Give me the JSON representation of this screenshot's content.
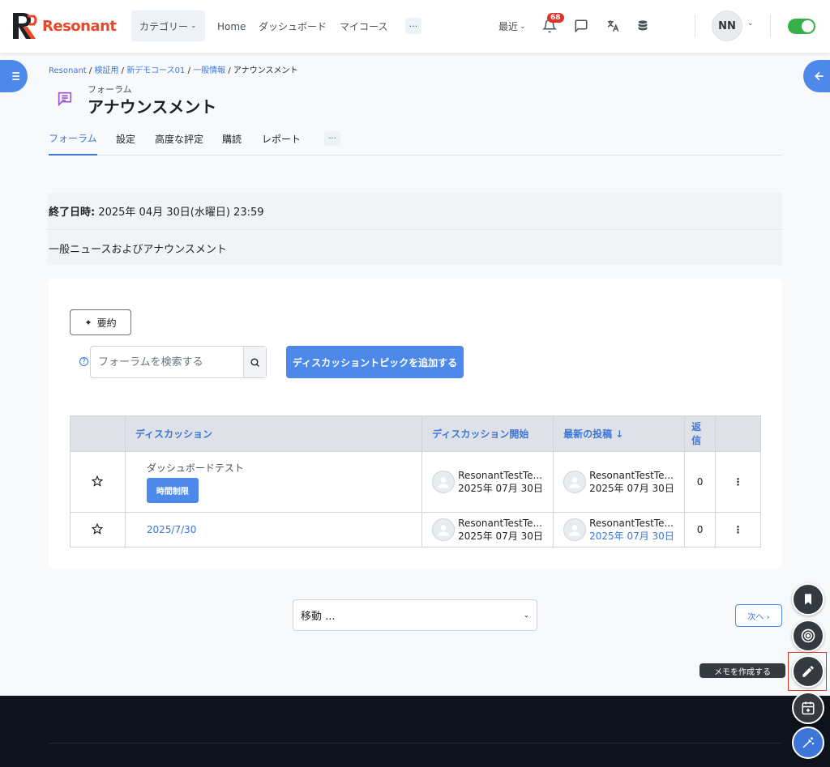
{
  "brand": {
    "name": "Resonant"
  },
  "nav": {
    "category_label": "カテゴリー",
    "links": [
      "Home",
      "ダッシュボード",
      "マイコース"
    ],
    "more": "···",
    "recent_label": "最近",
    "notification_count": "68",
    "user_initials": "NN"
  },
  "breadcrumb": {
    "items": [
      "Resonant",
      "検証用",
      "新デモコース01",
      "一般情報"
    ],
    "current": "アナウンスメント"
  },
  "page": {
    "subtitle": "フォーラム",
    "title": "アナウンスメント"
  },
  "tabs": [
    "フォーラム",
    "設定",
    "高度な評定",
    "購読",
    "レポート"
  ],
  "tabs_more": "···",
  "due": {
    "label": "終了日時:",
    "value": "2025年 04月 30日(水曜日) 23:59"
  },
  "description": "一般ニュースおよびアナウンスメント",
  "toolbar": {
    "summary_label": "要約",
    "search_placeholder": "フォーラムを検索する",
    "add_topic_label": "ディスカッショントピックを追加する"
  },
  "table": {
    "headers": {
      "discussion": "ディスカッション",
      "started": "ディスカッション開始",
      "latest": "最新の投稿 ↓",
      "replies": "返信"
    },
    "rows": [
      {
        "name": "ダッシュボードテスト",
        "badge": "時間制限",
        "started_by": "ResonantTestTe...",
        "started_date": "2025年 07月 30日",
        "latest_by": "ResonantTestTe...",
        "latest_date": "2025年 07月 30日",
        "replies": "0"
      },
      {
        "name": "2025/7/30",
        "started_by": "ResonantTestTe...",
        "started_date": "2025年 07月 30日",
        "latest_by": "ResonantTestTe...",
        "latest_date": "2025年 07月 30日",
        "replies": "0"
      }
    ]
  },
  "jump": {
    "label": "移動 ..."
  },
  "next": {
    "label": "次へ ›"
  },
  "tooltip": "メモを作成する",
  "colors": {
    "accent": "#4d89ea",
    "brand": "#e8472a",
    "footer": "#0e121b",
    "toggle": "#36b04a"
  }
}
